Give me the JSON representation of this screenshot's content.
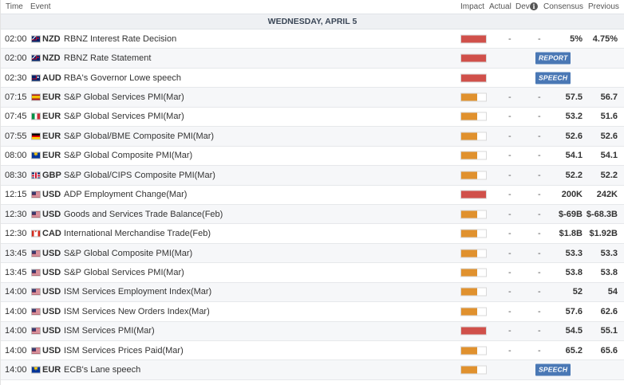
{
  "header": {
    "time": "Time",
    "event": "Event",
    "impact": "Impact",
    "actual": "Actual",
    "dev": "Dev",
    "consensus": "Consensus",
    "previous": "Previous",
    "info_icon": "i"
  },
  "day_label": "WEDNESDAY, APRIL 5",
  "colors": {
    "high": "#d0504a",
    "medium": "#e0912e",
    "badge": "#4a78b5"
  },
  "rows": [
    {
      "time": "02:00",
      "flag": "f-nz",
      "currency": "NZD",
      "event": "RBNZ Interest Rate Decision",
      "impact": "high",
      "actual": "-",
      "dev": "-",
      "consensus": "5%",
      "previous": "4.75%"
    },
    {
      "time": "02:00",
      "flag": "f-nz",
      "currency": "NZD",
      "event": "RBNZ Rate Statement",
      "impact": "high",
      "badge": "REPORT"
    },
    {
      "time": "02:30",
      "flag": "f-au",
      "currency": "AUD",
      "event": "RBA's Governor Lowe speech",
      "impact": "high",
      "badge": "SPEECH"
    },
    {
      "time": "07:15",
      "flag": "f-es",
      "currency": "EUR",
      "event": "S&P Global Services PMI(Mar)",
      "impact": "medium",
      "actual": "-",
      "dev": "-",
      "consensus": "57.5",
      "previous": "56.7"
    },
    {
      "time": "07:45",
      "flag": "f-it",
      "currency": "EUR",
      "event": "S&P Global Services PMI(Mar)",
      "impact": "medium",
      "actual": "-",
      "dev": "-",
      "consensus": "53.2",
      "previous": "51.6"
    },
    {
      "time": "07:55",
      "flag": "f-de",
      "currency": "EUR",
      "event": "S&P Global/BME Composite PMI(Mar)",
      "impact": "medium",
      "actual": "-",
      "dev": "-",
      "consensus": "52.6",
      "previous": "52.6"
    },
    {
      "time": "08:00",
      "flag": "f-eu",
      "currency": "EUR",
      "event": "S&P Global Composite PMI(Mar)",
      "impact": "medium",
      "actual": "-",
      "dev": "-",
      "consensus": "54.1",
      "previous": "54.1"
    },
    {
      "time": "08:30",
      "flag": "f-gb",
      "currency": "GBP",
      "event": "S&P Global/CIPS Composite PMI(Mar)",
      "impact": "medium",
      "actual": "-",
      "dev": "-",
      "consensus": "52.2",
      "previous": "52.2"
    },
    {
      "time": "12:15",
      "flag": "f-us",
      "currency": "USD",
      "event": "ADP Employment Change(Mar)",
      "impact": "high",
      "actual": "-",
      "dev": "-",
      "consensus": "200K",
      "previous": "242K"
    },
    {
      "time": "12:30",
      "flag": "f-us",
      "currency": "USD",
      "event": "Goods and Services Trade Balance(Feb)",
      "impact": "medium",
      "actual": "-",
      "dev": "-",
      "consensus": "$-69B",
      "previous": "$-68.3B"
    },
    {
      "time": "12:30",
      "flag": "f-ca",
      "currency": "CAD",
      "event": "International Merchandise Trade(Feb)",
      "impact": "medium",
      "actual": "-",
      "dev": "-",
      "consensus": "$1.8B",
      "previous": "$1.92B"
    },
    {
      "time": "13:45",
      "flag": "f-us",
      "currency": "USD",
      "event": "S&P Global Composite PMI(Mar)",
      "impact": "medium",
      "actual": "-",
      "dev": "-",
      "consensus": "53.3",
      "previous": "53.3"
    },
    {
      "time": "13:45",
      "flag": "f-us",
      "currency": "USD",
      "event": "S&P Global Services PMI(Mar)",
      "impact": "medium",
      "actual": "-",
      "dev": "-",
      "consensus": "53.8",
      "previous": "53.8"
    },
    {
      "time": "14:00",
      "flag": "f-us",
      "currency": "USD",
      "event": "ISM Services Employment Index(Mar)",
      "impact": "medium",
      "actual": "-",
      "dev": "-",
      "consensus": "52",
      "previous": "54"
    },
    {
      "time": "14:00",
      "flag": "f-us",
      "currency": "USD",
      "event": "ISM Services New Orders Index(Mar)",
      "impact": "medium",
      "actual": "-",
      "dev": "-",
      "consensus": "57.6",
      "previous": "62.6"
    },
    {
      "time": "14:00",
      "flag": "f-us",
      "currency": "USD",
      "event": "ISM Services PMI(Mar)",
      "impact": "high",
      "actual": "-",
      "dev": "-",
      "consensus": "54.5",
      "previous": "55.1"
    },
    {
      "time": "14:00",
      "flag": "f-us",
      "currency": "USD",
      "event": "ISM Services Prices Paid(Mar)",
      "impact": "medium",
      "actual": "-",
      "dev": "-",
      "consensus": "65.2",
      "previous": "65.6"
    },
    {
      "time": "14:00",
      "flag": "f-eu",
      "currency": "EUR",
      "event": "ECB's Lane speech",
      "impact": "medium",
      "badge": "SPEECH"
    }
  ]
}
